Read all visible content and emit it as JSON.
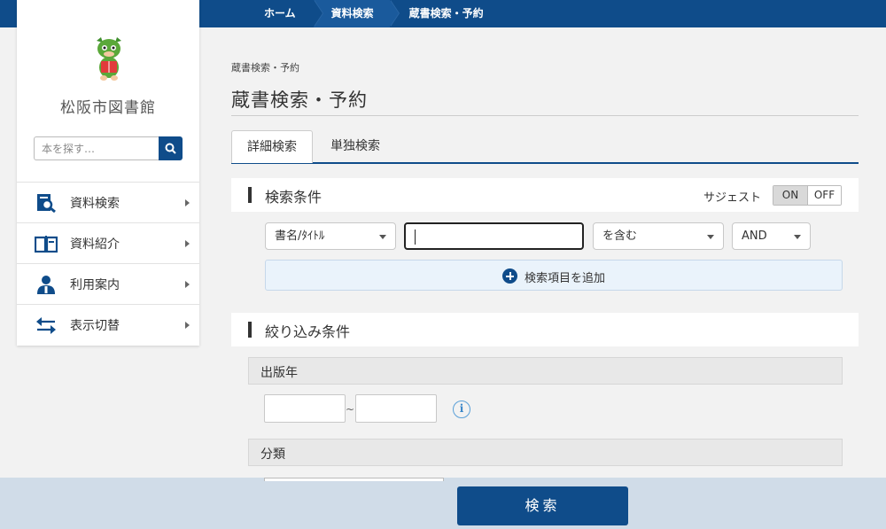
{
  "nav": {
    "crumbs": [
      "ホーム",
      "資料検索",
      "蔵書検索・予約"
    ]
  },
  "sidebar": {
    "library_name": "松阪市図書館",
    "search_placeholder": "本を探す…",
    "items": [
      {
        "label": "資料検索",
        "icon": "search-document-icon"
      },
      {
        "label": "資料紹介",
        "icon": "open-book-icon"
      },
      {
        "label": "利用案内",
        "icon": "person-icon"
      },
      {
        "label": "表示切替",
        "icon": "switch-arrows-icon"
      }
    ]
  },
  "main": {
    "breadcrumb": "蔵書検索・予約",
    "title": "蔵書検索・予約",
    "tabs": [
      {
        "label": "詳細検索",
        "active": true
      },
      {
        "label": "単独検索",
        "active": false
      }
    ],
    "conditions": {
      "title": "検索条件",
      "suggest_label": "サジェスト",
      "toggle_on": "ON",
      "toggle_off": "OFF",
      "field_select": "書名/ﾀｲﾄﾙ",
      "keyword_value": "",
      "match_select": "を含む",
      "logic_select": "AND",
      "add_label": "検索項目を追加"
    },
    "filters": {
      "title": "絞り込み条件",
      "year_label": "出版年",
      "range_sep": "~",
      "info_glyph": "i",
      "class_label": "分類"
    },
    "search_button": "検索"
  },
  "colors": {
    "primary": "#0f4c8a",
    "add_row_bg": "#eaf3fb",
    "bottom_bar": "#d0dce8"
  }
}
